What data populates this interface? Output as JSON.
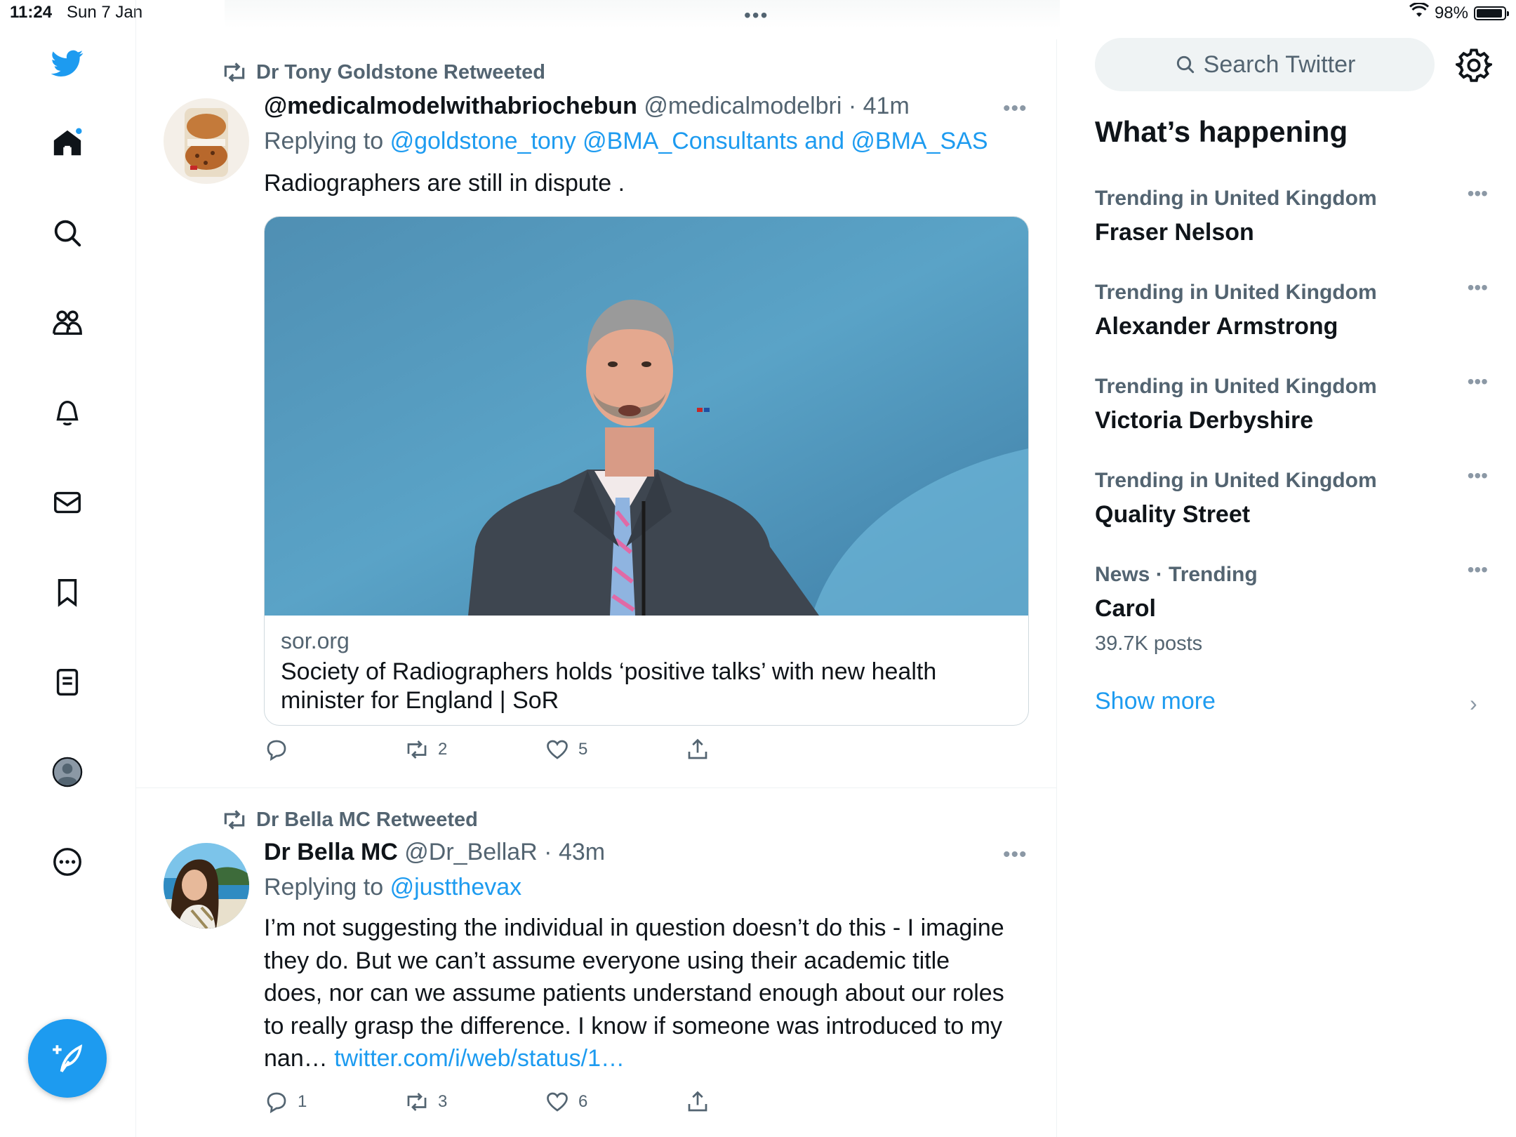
{
  "status_bar": {
    "time": "11:24",
    "date": "Sun 7 Jan",
    "battery": "98%"
  },
  "sidebar": {
    "items": [
      {
        "icon": "twitter-logo-icon"
      },
      {
        "icon": "home-icon"
      },
      {
        "icon": "search-icon"
      },
      {
        "icon": "communities-icon"
      },
      {
        "icon": "notifications-icon"
      },
      {
        "icon": "messages-icon"
      },
      {
        "icon": "bookmarks-icon"
      },
      {
        "icon": "lists-icon"
      },
      {
        "icon": "profile-icon"
      },
      {
        "icon": "more-icon"
      }
    ],
    "compose_icon": "compose-icon"
  },
  "tweets": [
    {
      "retweeted_by": "Dr Tony Goldstone Retweeted",
      "name": "@medicalmodelwithabriochebun",
      "handle_time": "@medicalmodelbri · 41m",
      "replying_prefix": "Replying to",
      "replying_to": "@goldstone_tony @BMA_Consultants and @BMA_SAS",
      "text": "Radiographers are still in dispute .",
      "card": {
        "domain": "sor.org",
        "title": "Society of Radiographers holds ‘positive talks’ with new health minister for England | SoR"
      },
      "actions": {
        "replies": "",
        "retweets": "2",
        "likes": "5"
      }
    },
    {
      "retweeted_by": "Dr Bella MC Retweeted",
      "name": "Dr Bella MC",
      "handle_time": "@Dr_BellaR · 43m",
      "replying_prefix": "Replying to",
      "replying_to": "@justthevax",
      "text": "I’m not suggesting the individual in question doesn’t do this - I imagine they do. But we can’t assume everyone using their academic title does, nor can we assume patients understand enough about our roles to really grasp the difference. I know if someone was introduced to my nan…",
      "text_link": "twitter.com/i/web/status/1…",
      "actions": {
        "replies": "1",
        "retweets": "3",
        "likes": "6"
      }
    }
  ],
  "right_panel": {
    "search_placeholder": "Search Twitter",
    "heading": "What’s happening",
    "trends": [
      {
        "context": "Trending in United Kingdom",
        "name": "Fraser Nelson",
        "count": ""
      },
      {
        "context": "Trending in United Kingdom",
        "name": "Alexander Armstrong",
        "count": ""
      },
      {
        "context": "Trending in United Kingdom",
        "name": "Victoria Derbyshire",
        "count": ""
      },
      {
        "context": "Trending in United Kingdom",
        "name": "Quality Street",
        "count": ""
      },
      {
        "context": "News · Trending",
        "name": "Carol",
        "count": "39.7K posts"
      }
    ],
    "show_more": "Show more"
  },
  "colors": {
    "accent": "#1d9bf0",
    "text": "#0f1419",
    "secondary": "#536471",
    "border": "#eff3f4"
  }
}
